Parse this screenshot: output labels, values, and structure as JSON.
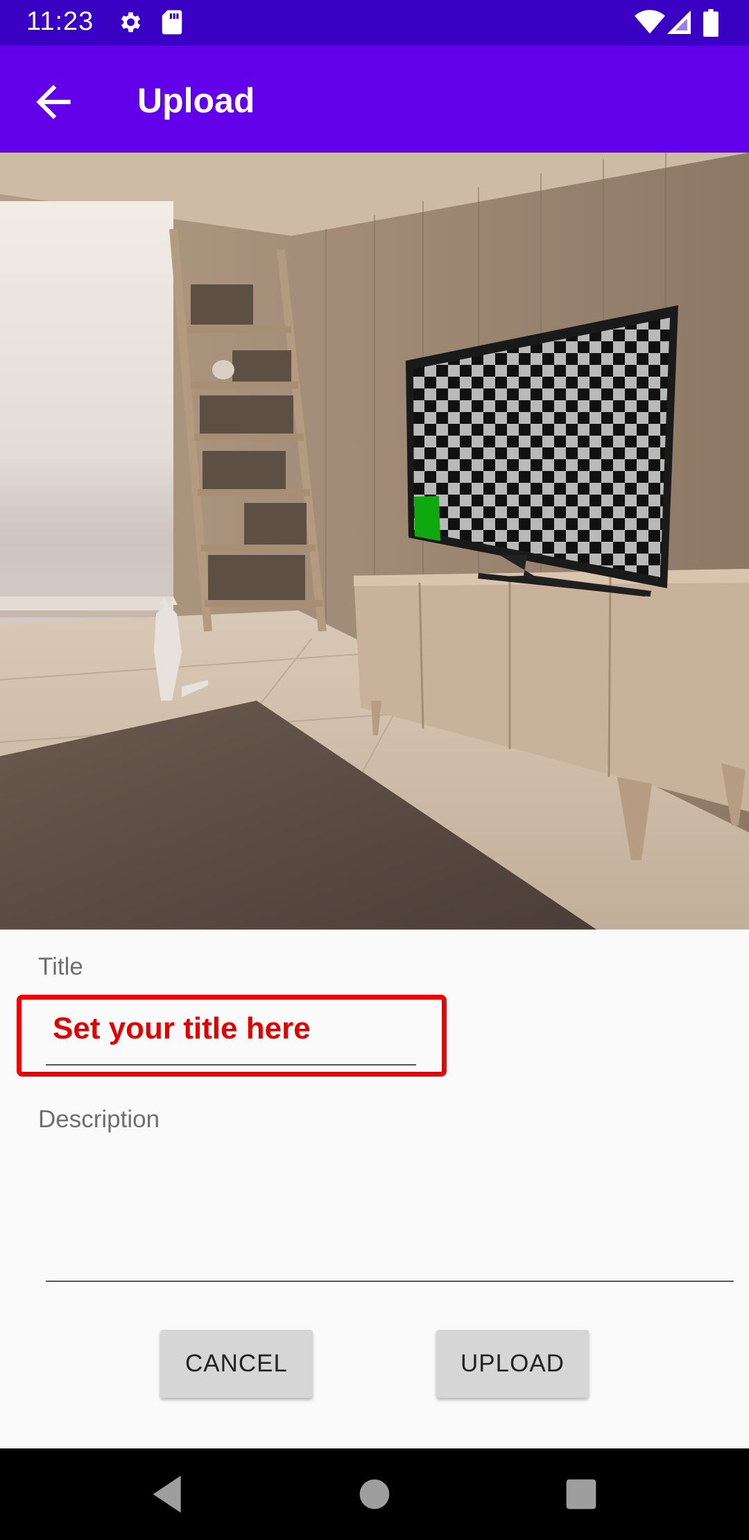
{
  "status_bar": {
    "time": "11:23",
    "icons": [
      "settings-icon",
      "sd-card-icon",
      "wifi-icon",
      "signal-icon",
      "battery-icon"
    ]
  },
  "app_bar": {
    "title": "Upload",
    "back_icon": "arrow-back-icon",
    "background": "#6200ea"
  },
  "form": {
    "title_label": "Title",
    "title_value": "Set your title here",
    "description_label": "Description",
    "description_value": ""
  },
  "buttons": {
    "cancel_label": "CANCEL",
    "upload_label": "UPLOAD"
  },
  "colors": {
    "status_bar": "#3a00c4",
    "accent": "#6200ea",
    "highlight": "#ee0000",
    "tv_marker": "#0fa80f"
  },
  "nav_bar": {
    "icons": [
      "back-triangle-icon",
      "home-circle-icon",
      "recents-square-icon"
    ]
  }
}
